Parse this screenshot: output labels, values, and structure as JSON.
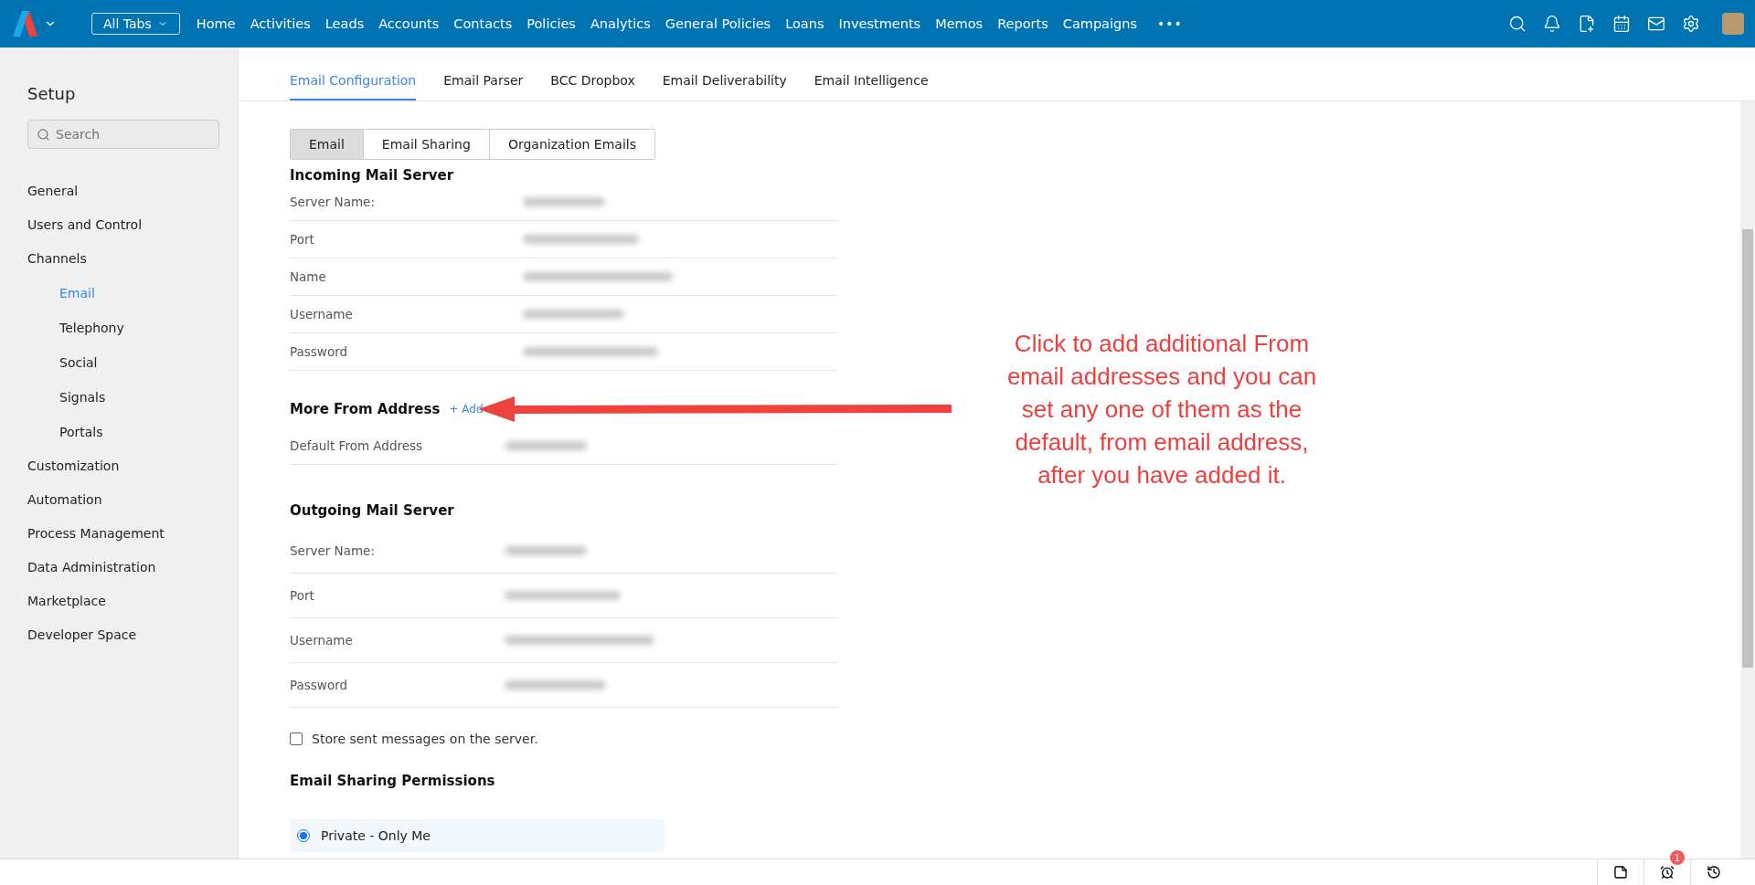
{
  "nav": {
    "tabs_button": "All Tabs",
    "items": [
      {
        "label": "Home"
      },
      {
        "label": "Activities"
      },
      {
        "label": "Leads"
      },
      {
        "label": "Accounts"
      },
      {
        "label": "Contacts"
      },
      {
        "label": "Policies"
      },
      {
        "label": "Analytics"
      },
      {
        "label": "General Policies"
      },
      {
        "label": "Loans"
      },
      {
        "label": "Investments"
      },
      {
        "label": "Memos"
      },
      {
        "label": "Reports"
      },
      {
        "label": "Campaigns"
      }
    ],
    "more": "•••"
  },
  "sidebar": {
    "title": "Setup",
    "search_placeholder": "Search",
    "items": [
      {
        "label": "General",
        "selected": false
      },
      {
        "label": "Users and Control",
        "selected": false
      },
      {
        "label": "Channels",
        "selected": false,
        "children": [
          {
            "label": "Email",
            "selected": true
          },
          {
            "label": "Telephony",
            "selected": false
          },
          {
            "label": "Social",
            "selected": false
          },
          {
            "label": "Signals",
            "selected": false
          },
          {
            "label": "Portals",
            "selected": false
          }
        ]
      },
      {
        "label": "Customization",
        "selected": false
      },
      {
        "label": "Automation",
        "selected": false
      },
      {
        "label": "Process Management",
        "selected": false
      },
      {
        "label": "Data Administration",
        "selected": false
      },
      {
        "label": "Marketplace",
        "selected": false
      },
      {
        "label": "Developer Space",
        "selected": false
      }
    ]
  },
  "tabs": [
    {
      "label": "Email Configuration",
      "selected": true
    },
    {
      "label": "Email Parser",
      "selected": false
    },
    {
      "label": "BCC Dropbox",
      "selected": false
    },
    {
      "label": "Email Deliverability",
      "selected": false
    },
    {
      "label": "Email Intelligence",
      "selected": false
    }
  ],
  "segments": [
    {
      "label": "Email",
      "selected": true
    },
    {
      "label": "Email Sharing",
      "selected": false
    },
    {
      "label": "Organization Emails",
      "selected": false
    }
  ],
  "incoming": {
    "heading": "Incoming Mail Server",
    "fields": [
      {
        "label": "Server Name:"
      },
      {
        "label": "Port"
      },
      {
        "label": "Name"
      },
      {
        "label": "Username"
      },
      {
        "label": "Password"
      }
    ]
  },
  "more_from": {
    "heading": "More From Address",
    "add_link": "+ Add",
    "fields": [
      {
        "label": "Default From Address"
      }
    ]
  },
  "outgoing": {
    "heading": "Outgoing Mail Server",
    "fields": [
      {
        "label": "Server Name:"
      },
      {
        "label": "Port"
      },
      {
        "label": "Username"
      },
      {
        "label": "Password"
      }
    ]
  },
  "store_sent": {
    "label": "Store sent messages on the server.",
    "checked": false
  },
  "sharing": {
    "heading": "Email Sharing Permissions",
    "options": [
      {
        "label": "Private - Only Me",
        "selected": true
      }
    ]
  },
  "annotation": "Click to add additional From\nemail addresses and you can\nset any one of them as the\ndefault, from email address,\nafter you have added it.",
  "status_bar": {
    "alarm_badge": "1"
  }
}
